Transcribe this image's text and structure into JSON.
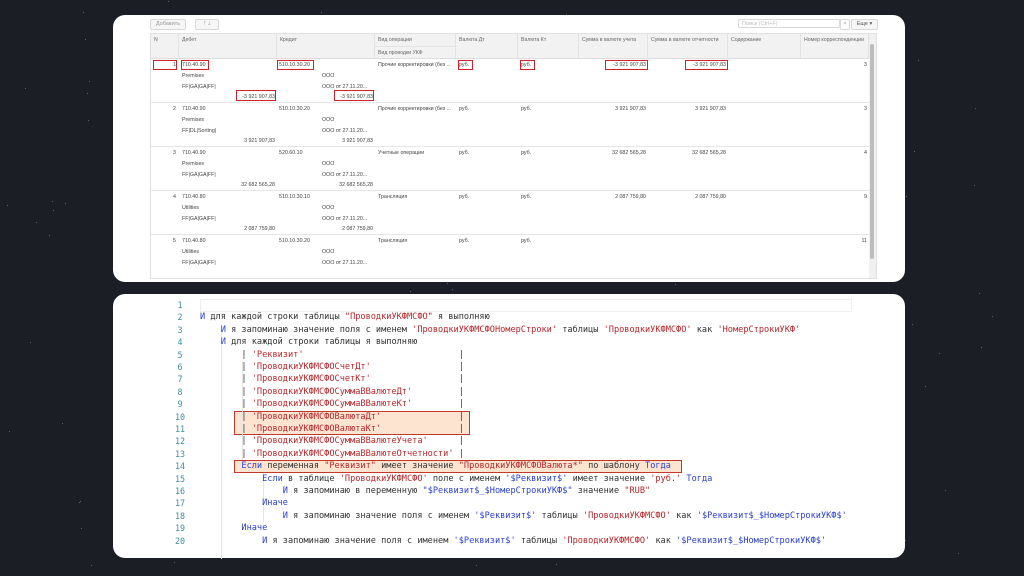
{
  "toolbar": {
    "add_label": "Добавить",
    "up_icon": "arrow-up-icon",
    "down_icon": "arrow-down-icon",
    "search_placeholder": "Поиск (Ctrl+F)",
    "clear_label": "×",
    "more_label": "Еще ▾"
  },
  "table": {
    "headers": {
      "n": "N",
      "debit": "Дебет",
      "credit": "Кредит",
      "op": "Вид операции",
      "op_sub": "Вид проводки УКФ",
      "cur_dt": "Валюта Дт",
      "cur_kt": "Валюта Кт",
      "sum_acc": "Сумма в валюте учета",
      "sum_rep": "Сумма в валюте отчетности",
      "content": "Содержание",
      "corr": "Номер корреспонденции"
    },
    "rows": [
      {
        "n": "1",
        "debit": {
          "account": "710.40.90",
          "sub1": "Premises",
          "sub2": "FF|GA|GA|FF|",
          "amount": "-3 921 907,83"
        },
        "credit": {
          "account": "510.10.30.20",
          "sub1": "ООО",
          "sub2": "ООО от 27.11.20...",
          "amount": "-3 921 907,83"
        },
        "op": "Прочие корректировки (без ...",
        "cur_dt": "руб.",
        "cur_kt": "руб.",
        "sum_acc": "-3 921 907,83",
        "sum_rep": "-3 921 907,83",
        "content": "",
        "corr": "3",
        "highlighted": true
      },
      {
        "n": "2",
        "debit": {
          "account": "710.40.90",
          "sub1": "Premises",
          "sub2": "FF|DL|Sorting|",
          "amount": "3 921 907,83"
        },
        "credit": {
          "account": "510.10.30.20",
          "sub1": "ООО",
          "sub2": "ООО от 27.11.20...",
          "amount": "3 921 907,83"
        },
        "op": "Прочие корректировки (без ...",
        "cur_dt": "руб.",
        "cur_kt": "руб.",
        "sum_acc": "3 921 907,83",
        "sum_rep": "3 921 907,83",
        "content": "",
        "corr": "3"
      },
      {
        "n": "3",
        "debit": {
          "account": "710.40.90",
          "sub1": "Premises",
          "sub2": "FF|GA|GA|FF|",
          "amount": "32 682 565,28"
        },
        "credit": {
          "account": "520.60.10",
          "sub1": "ООО",
          "sub2": "ООО от 27.11.20...",
          "amount": "32 682 565,28"
        },
        "op": "Учетные операции",
        "cur_dt": "руб.",
        "cur_kt": "руб.",
        "sum_acc": "32 682 565,28",
        "sum_rep": "32 682 565,28",
        "content": "",
        "corr": "4"
      },
      {
        "n": "4",
        "debit": {
          "account": "710.40.80",
          "sub1": "Utilities",
          "sub2": "FF|GA|GA|FF|",
          "amount": "2 087 759,80"
        },
        "credit": {
          "account": "510.10.30.10",
          "sub1": "ООО",
          "sub2": "ООО от 27.11.20...",
          "amount": "2 087 759,80"
        },
        "op": "Трансляция",
        "cur_dt": "руб.",
        "cur_kt": "руб.",
        "sum_acc": "2 087 759,80",
        "sum_rep": "2 087 759,80",
        "content": "",
        "corr": "9"
      },
      {
        "n": "5",
        "debit": {
          "account": "710.40.80",
          "sub1": "Utilities",
          "sub2": "FF|GA|GA|FF|",
          "amount": ""
        },
        "credit": {
          "account": "510.10.30.20",
          "sub1": "ООО",
          "sub2": "ООО от 27.11.20...",
          "amount": ""
        },
        "op": "Трансляция",
        "cur_dt": "руб.",
        "cur_kt": "руб.",
        "sum_acc": "",
        "sum_rep": "",
        "content": "",
        "corr": "11"
      }
    ]
  },
  "highlight_color": "#d0202a",
  "code": {
    "lines": [
      [],
      [
        [
          "k",
          "И"
        ],
        [
          "t",
          " для каждой строки таблицы "
        ],
        [
          "s",
          "\"ПроводкиУКФМСФО\""
        ],
        [
          "t",
          " я выполняю"
        ]
      ],
      [
        [
          "t",
          "    "
        ],
        [
          "k",
          "И"
        ],
        [
          "t",
          " я запоминаю значение поля с именем "
        ],
        [
          "s",
          "'ПроводкиУКФМСФОНомерСтроки'"
        ],
        [
          "t",
          " таблицы "
        ],
        [
          "s",
          "'ПроводкиУКФМСФО'"
        ],
        [
          "t",
          " как "
        ],
        [
          "s",
          "'НомерСтрокиУКФ'"
        ]
      ],
      [
        [
          "t",
          "    "
        ],
        [
          "k",
          "И"
        ],
        [
          "t",
          " для каждой строки таблицы я выполняю"
        ]
      ],
      [
        [
          "t",
          "        | "
        ],
        [
          "s",
          "'Реквизит'"
        ],
        [
          "p",
          "|"
        ]
      ],
      [
        [
          "t",
          "        | "
        ],
        [
          "s",
          "'ПроводкиУКФМСФОСчетДт'"
        ],
        [
          "p",
          "|"
        ]
      ],
      [
        [
          "t",
          "        | "
        ],
        [
          "s",
          "'ПроводкиУКФМСФОСчетКт'"
        ],
        [
          "p",
          "|"
        ]
      ],
      [
        [
          "t",
          "        | "
        ],
        [
          "s",
          "'ПроводкиУКФМСФОСуммаВВалютеДт'"
        ],
        [
          "p",
          "|"
        ]
      ],
      [
        [
          "t",
          "        | "
        ],
        [
          "s",
          "'ПроводкиУКФМСФОСуммаВВалютеКт'"
        ],
        [
          "p",
          "|"
        ]
      ],
      [
        [
          "t",
          "        | "
        ],
        [
          "s",
          "'ПроводкиУКФМСФОВалютаДт'"
        ],
        [
          "p",
          "|"
        ]
      ],
      [
        [
          "t",
          "        | "
        ],
        [
          "s",
          "'ПроводкиУКФМСФОВалютаКт'"
        ],
        [
          "p",
          "|"
        ]
      ],
      [
        [
          "t",
          "        | "
        ],
        [
          "s",
          "'ПроводкиУКФМСФОСуммаВВалютеУчета'"
        ],
        [
          "p",
          "|"
        ]
      ],
      [
        [
          "t",
          "        | "
        ],
        [
          "s",
          "'ПроводкиУКФМСФОСуммаВВалютеОтчетности'"
        ],
        [
          "p",
          "|"
        ]
      ],
      [
        [
          "t",
          "        "
        ],
        [
          "k",
          "Если"
        ],
        [
          "t",
          " переменная "
        ],
        [
          "s",
          "\"Реквизит\""
        ],
        [
          "t",
          " имеет значение "
        ],
        [
          "s",
          "\"ПроводкиУКФМСФОВалюта*\""
        ],
        [
          "t",
          " по шаблону "
        ],
        [
          "k",
          "Тогда"
        ]
      ],
      [
        [
          "t",
          "            "
        ],
        [
          "k",
          "Если"
        ],
        [
          "t",
          " в таблице "
        ],
        [
          "s",
          "'ПроводкиУКФМСФО'"
        ],
        [
          "t",
          " поле с именем "
        ],
        [
          "v",
          "'$Реквизит$'"
        ],
        [
          "t",
          " имеет значение "
        ],
        [
          "s",
          "'руб.'"
        ],
        [
          "t",
          " "
        ],
        [
          "k",
          "Тогда"
        ]
      ],
      [
        [
          "t",
          "                "
        ],
        [
          "k",
          "И"
        ],
        [
          "t",
          " я запоминаю в переменную "
        ],
        [
          "v",
          "\"$Реквизит$_$НомерСтрокиУКФ$\""
        ],
        [
          "t",
          " значение "
        ],
        [
          "s",
          "\"RUB\""
        ]
      ],
      [
        [
          "t",
          "            "
        ],
        [
          "k",
          "Иначе"
        ]
      ],
      [
        [
          "t",
          "                "
        ],
        [
          "k",
          "И"
        ],
        [
          "t",
          " я запоминаю значение поля с именем "
        ],
        [
          "v",
          "'$Реквизит$'"
        ],
        [
          "t",
          " таблицы "
        ],
        [
          "s",
          "'ПроводкиУКФМСФО'"
        ],
        [
          "t",
          " как "
        ],
        [
          "v",
          "'$Реквизит$_$НомерСтрокиУКФ$'"
        ]
      ],
      [
        [
          "t",
          "        "
        ],
        [
          "k",
          "Иначе"
        ]
      ],
      [
        [
          "t",
          "            "
        ],
        [
          "k",
          "И"
        ],
        [
          "t",
          " я запоминаю значение поля с именем "
        ],
        [
          "v",
          "'$Реквизит$'"
        ],
        [
          "t",
          " таблицы "
        ],
        [
          "s",
          "'ПроводкиУКФМСФО'"
        ],
        [
          "t",
          " как "
        ],
        [
          "v",
          "'$Реквизит$_$НомерСтрокиУКФ$'"
        ]
      ]
    ],
    "highlight_fill": "#fde4d0",
    "highlight_border": "#c0392b"
  }
}
